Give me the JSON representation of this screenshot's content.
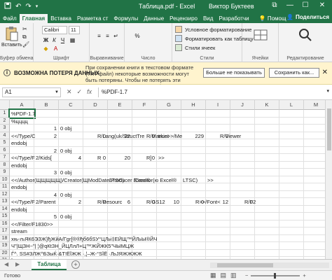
{
  "titlebar": {
    "title": "Таблица.pdf  -  Excel",
    "user": "Виктор Буктеев",
    "save_icon": "save-icon",
    "undo_icon": "undo-icon",
    "redo_icon": "redo-icon",
    "minimize": "—",
    "maximize": "☐",
    "close": "✕",
    "ribbon_opts": "⧉"
  },
  "tabs": [
    {
      "label": "Файл"
    },
    {
      "label": "Главная"
    },
    {
      "label": "Вставка"
    },
    {
      "label": "Разметка ст"
    },
    {
      "label": "Формулы"
    },
    {
      "label": "Данные"
    },
    {
      "label": "Рецензиро"
    },
    {
      "label": "Вид"
    },
    {
      "label": "Разработчи"
    }
  ],
  "tellme": "Помощ",
  "share": "Поделиться",
  "ribbon": {
    "clipboard": {
      "paste": "Вставить",
      "label": "Буфер обмена"
    },
    "font": {
      "name": "Calibri",
      "size": "11",
      "bold": "Ж",
      "italic": "К",
      "underline": "Ч",
      "label": "Шрифт"
    },
    "alignment": {
      "label": "Выравнивание"
    },
    "number": {
      "format": "Общий",
      "label": "Число",
      "percent": "%"
    },
    "styles": {
      "cond": "Условное форматирование",
      "table": "Форматировать как таблицу",
      "cell": "Стили ячеек",
      "label": "Стили"
    },
    "cells": {
      "label": "Ячейки"
    },
    "editing": {
      "label": "Редактирование"
    }
  },
  "warning": {
    "title": "ВОЗМОЖНА ПОТЕРЯ ДАННЫХ",
    "message": "При сохранении книги в текстовом формате (TXT-файл) некоторые возможности могут быть потеряны. Чтобы не потерять эти возможности, сохраните ее в формате файла Excel.",
    "btn_hide": "Больше не показывать",
    "btn_save": "Сохранить как...",
    "close": "✕"
  },
  "formula": {
    "namebox": "A1",
    "fx": "fx",
    "value": "%PDF-1.7"
  },
  "columns": [
    "A",
    "B",
    "C",
    "D",
    "E",
    "F",
    "G",
    "H",
    "I",
    "J",
    "K",
    "L",
    "M"
  ],
  "rows": [
    {
      "n": "1",
      "cells": [
        {
          "c": 0,
          "t": "%PDF-1.7"
        }
      ]
    },
    {
      "n": "2",
      "cells": [
        {
          "c": 0,
          "t": "%цццц"
        }
      ]
    },
    {
      "n": "3",
      "cells": [
        {
          "c": 1,
          "t": "1",
          "r": true
        },
        {
          "c": 2,
          "t": "0 obj"
        }
      ]
    },
    {
      "n": "4",
      "cells": [
        {
          "c": 0,
          "t": "<</Type/C"
        },
        {
          "c": 1,
          "t": "2",
          "r": true
        },
        {
          "c": 3,
          "t": "0",
          "r": true
        },
        {
          "c": 3,
          "t": "R/Lang(uk/StructTre",
          "o": 18
        },
        {
          "c": 4,
          "t": "22",
          "r": true
        },
        {
          "c": 5,
          "t": "0",
          "r": true
        },
        {
          "c": 5,
          "t": "R/Markint",
          "o": 18
        },
        {
          "c": 6,
          "t": "true>>/Me"
        },
        {
          "c": 7,
          "t": "229",
          "r": true
        },
        {
          "c": 8,
          "t": "0",
          "r": true
        },
        {
          "c": 8,
          "t": "R/Viewer",
          "o": 18
        }
      ]
    },
    {
      "n": "5",
      "cells": [
        {
          "c": 0,
          "t": "endobj"
        }
      ]
    },
    {
      "n": "6",
      "cells": [
        {
          "c": 1,
          "t": "2",
          "r": true
        },
        {
          "c": 2,
          "t": "0 obj"
        }
      ]
    },
    {
      "n": "7",
      "cells": [
        {
          "c": 0,
          "t": "<</Type/F"
        },
        {
          "c": 1,
          "t": "2/Kids["
        },
        {
          "c": 2,
          "t": "4",
          "r": true
        },
        {
          "c": 3,
          "t": "0",
          "r": true
        },
        {
          "c": 3,
          "t": "R",
          "o": 18
        },
        {
          "c": 4,
          "t": "20",
          "r": true
        },
        {
          "c": 5,
          "t": "0",
          "r": true
        },
        {
          "c": 5,
          "t": "R]",
          "o": 18
        },
        {
          "c": 6,
          "t": ">>"
        }
      ]
    },
    {
      "n": "8",
      "cells": [
        {
          "c": 0,
          "t": "endobj"
        }
      ]
    },
    {
      "n": "9",
      "cells": [
        {
          "c": 1,
          "t": "3",
          "r": true
        },
        {
          "c": 2,
          "t": "0 obj"
        }
      ]
    },
    {
      "n": "10",
      "cells": [
        {
          "c": 0,
          "t": "<</Author(ЩЩЩЩЩ)/Creator(ЩModDate/Producer Excel®"
        },
        {
          "c": 4,
          "t": "LTSC)"
        },
        {
          "c": 5,
          "t": "/Creator(ю Excel®"
        },
        {
          "c": 7,
          "t": "LTSC)"
        },
        {
          "c": 8,
          "t": ">>"
        }
      ]
    },
    {
      "n": "11",
      "cells": [
        {
          "c": 0,
          "t": "endobj"
        }
      ]
    },
    {
      "n": "12",
      "cells": [
        {
          "c": 1,
          "t": "4",
          "r": true
        },
        {
          "c": 2,
          "t": "0 obj"
        }
      ]
    },
    {
      "n": "13",
      "cells": [
        {
          "c": 0,
          "t": "<</Type/F"
        },
        {
          "c": 1,
          "t": "2/Parent",
          "o": 0
        },
        {
          "c": 2,
          "t": "2",
          "r": true
        },
        {
          "c": 3,
          "t": "0",
          "r": true
        },
        {
          "c": 3,
          "t": "R/Resourc",
          "o": 18
        },
        {
          "c": 4,
          "t": "6",
          "r": true
        },
        {
          "c": 5,
          "t": "0",
          "r": true
        },
        {
          "c": 5,
          "t": "R/GS12",
          "o": 18
        },
        {
          "c": 6,
          "t": "10",
          "r": true
        },
        {
          "c": 7,
          "t": "0",
          "r": true
        },
        {
          "c": 7,
          "t": "R>>/Font<",
          "o": 18
        },
        {
          "c": 8,
          "t": "12",
          "r": true
        },
        {
          "c": 9,
          "t": "0",
          "r": true
        },
        {
          "c": 9,
          "t": "R/F2",
          "o": 18
        }
      ]
    },
    {
      "n": "14",
      "cells": [
        {
          "c": 0,
          "t": "endobj"
        }
      ]
    },
    {
      "n": "15",
      "cells": [
        {
          "c": 1,
          "t": "5",
          "r": true
        },
        {
          "c": 2,
          "t": "0 obj"
        }
      ]
    },
    {
      "n": "16",
      "cells": [
        {
          "c": 0,
          "t": "<</Filter/F1830>>"
        }
      ]
    },
    {
      "n": "17",
      "cells": [
        {
          "c": 0,
          "t": "stream"
        }
      ]
    },
    {
      "n": "18",
      "cells": [
        {
          "c": 0,
          "t": "xњ-љЯК6ЭЗЖ}ђЖйА/Гgr[®®ђб6бЅУ°ЦЉі‡ЕӢЩ™ЙЉЫ®ЙЧ"
        }
      ]
    },
    {
      "n": "19",
      "cells": [
        {
          "c": 0,
          "t": "Ч\"|ЩЗН~\"| ¦@qКtЗН_ЙЦЛлЛ+Ц™ЖЙЖК5\"ЧЫМЦЖ"
        }
      ]
    },
    {
      "n": "20",
      "cells": [
        {
          "c": 0,
          "t": "Ѓ^. ЅЅ#ЗЛЖ^БЗыЌ·&Т!ЁЇЖЖ ·,¦–Ж-°ЅЇЁ ·ЉЈЯЖЖЖЖ"
        }
      ]
    },
    {
      "n": "21",
      "cells": [
        {
          "c": 0,
          "t": "ЇЖКЖЖ ЅЖ^ЖЦЖ Ж Ж ЖЖЖ Ж ЖЖ ЖЖ ЖЖЖ"
        }
      ]
    }
  ],
  "sheet": {
    "name": "Таблица",
    "add": "+"
  },
  "status": {
    "ready": "Готово",
    "zoom_minus": "−",
    "zoom_plus": "+"
  }
}
